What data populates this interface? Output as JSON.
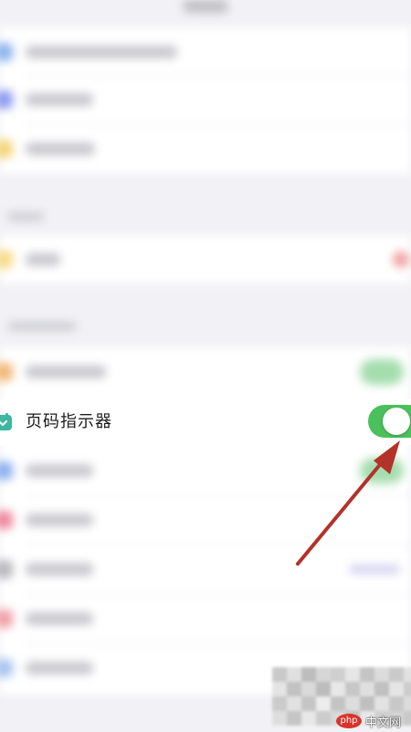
{
  "settings_row": {
    "label": "页码指示器",
    "toggle_state": "on",
    "icon": "page-indicator-icon"
  },
  "colors": {
    "toggle_on": "#4cc05c",
    "arrow": "#b3322a",
    "icon_teal": "#3fb6a0"
  },
  "watermark": {
    "logo_text": "php",
    "site_text": "中文网"
  }
}
